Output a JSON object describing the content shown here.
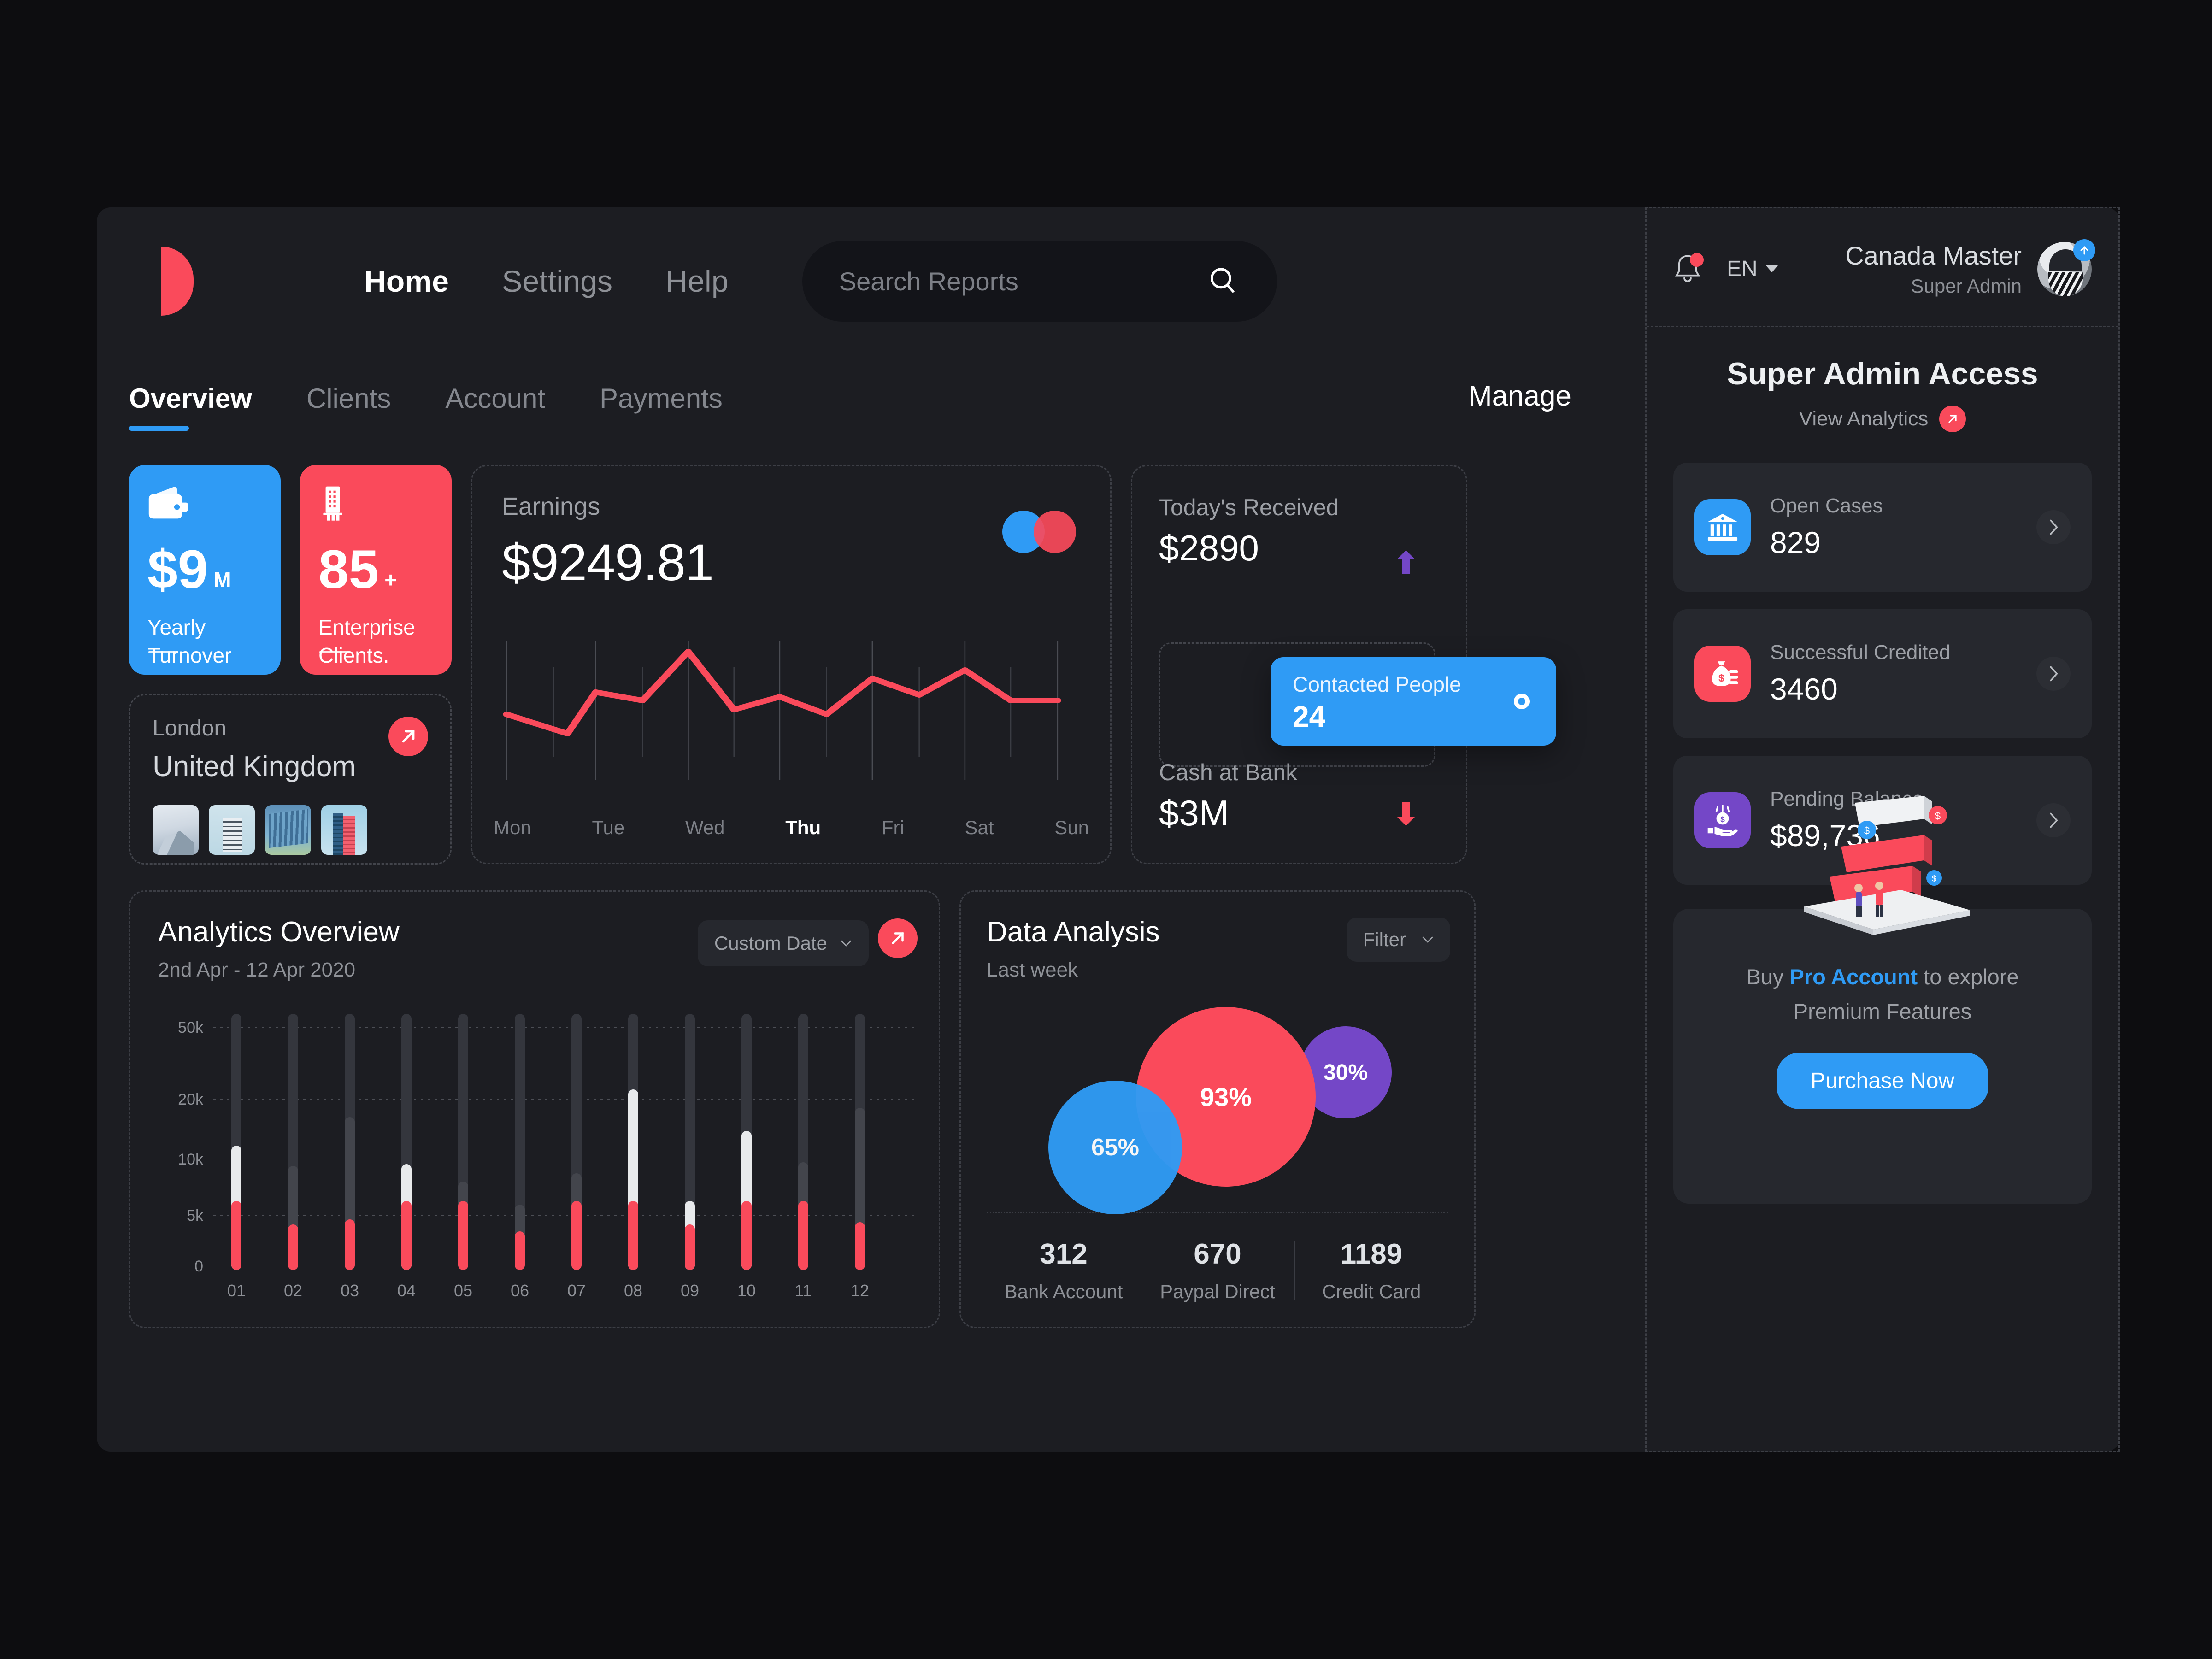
{
  "brand": {
    "logo_name": "half-circle-logo",
    "accent_red": "#fa4a5b",
    "accent_blue": "#2f9bf5",
    "accent_purple": "#7447c7"
  },
  "nav": {
    "items": [
      {
        "label": "Home",
        "active": true
      },
      {
        "label": "Settings",
        "active": false
      },
      {
        "label": "Help",
        "active": false
      }
    ]
  },
  "search": {
    "placeholder": "Search Reports",
    "value": ""
  },
  "tabs": {
    "items": [
      {
        "label": "Overview",
        "active": true
      },
      {
        "label": "Clients",
        "active": false
      },
      {
        "label": "Account",
        "active": false
      },
      {
        "label": "Payments",
        "active": false
      }
    ],
    "manage_label": "Manage"
  },
  "stat_cards": [
    {
      "value": "$9",
      "suffix": "M",
      "line1": "Yearly",
      "line2": "Turnover",
      "color": "#2f9bf5",
      "icon": "wallet-icon"
    },
    {
      "value": "85",
      "suffix": "+",
      "line1": "Enterprise",
      "line2": "Clients.",
      "color": "#fa4a5b",
      "icon": "building-icon"
    }
  ],
  "city_card": {
    "city": "London",
    "country": "United Kingdom"
  },
  "earnings": {
    "title": "Earnings",
    "amount": "$9249.81",
    "days": [
      "Mon",
      "Tue",
      "Wed",
      "Thu",
      "Fri",
      "Sat",
      "Sun"
    ],
    "current_day": "Thu"
  },
  "received": {
    "today_label": "Today's Received",
    "today_value": "$2890",
    "cash_label": "Cash at Bank",
    "cash_value": "$3M",
    "contacted_label": "Contacted People",
    "contacted_value": "24"
  },
  "analytics": {
    "title": "Analytics Overview",
    "subtitle": "2nd Apr - 12 Apr 2020",
    "date_filter_label": "Custom Date"
  },
  "data_analysis": {
    "title": "Data Analysis",
    "subtitle": "Last week",
    "filter_label": "Filter",
    "footer": [
      {
        "num": "312",
        "label": "Bank Account"
      },
      {
        "num": "670",
        "label": "Paypal Direct"
      },
      {
        "num": "1189",
        "label": "Credit Card"
      }
    ]
  },
  "sidebar": {
    "lang": "EN",
    "user_name": "Canada Master",
    "user_role": "Super Admin",
    "title": "Super Admin Access",
    "view_analytics": "View Analytics",
    "rows": [
      {
        "label": "Open Cases",
        "value": "829",
        "icon": "bank-icon",
        "color": "#2f9bf5"
      },
      {
        "label": "Successful Credited",
        "value": "3460",
        "icon": "money-bag-icon",
        "color": "#fa4a5b"
      },
      {
        "label": "Pending Balance",
        "value": "$89,736",
        "icon": "hand-coin-icon",
        "color": "#7447c7"
      }
    ],
    "promo": {
      "line1_a": "Buy ",
      "line1_b": "Pro Account",
      "line1_c": " to explore",
      "line2": "Premium Features",
      "button": "Purchase Now"
    }
  },
  "chart_data": [
    {
      "type": "line",
      "title": "Earnings",
      "x": [
        "Mon",
        "Tue",
        "Wed",
        "Thu",
        "Fri",
        "Sat",
        "Sun"
      ],
      "points_x": [
        0,
        7,
        14,
        21,
        28,
        36,
        43,
        50,
        57,
        64,
        71,
        79,
        86,
        93,
        100
      ],
      "values": [
        52,
        32,
        66,
        62,
        96,
        49,
        58,
        46,
        72,
        62,
        78,
        58,
        58
      ],
      "series": [
        {
          "name": "Earnings",
          "values": [
            52,
            32,
            66,
            62,
            96,
            49,
            58,
            46,
            72,
            62,
            78,
            58,
            58
          ]
        }
      ],
      "ylim": [
        0,
        100
      ],
      "grid": true,
      "legend": "none",
      "color": "#fa4a5b"
    },
    {
      "type": "bar",
      "title": "Analytics Overview",
      "subtitle": "2nd Apr - 12 Apr 2020",
      "categories": [
        "01",
        "02",
        "03",
        "04",
        "05",
        "06",
        "07",
        "08",
        "09",
        "10",
        "11",
        "12"
      ],
      "ytick_labels": [
        "0",
        "5k",
        "10k",
        "20k",
        "50k"
      ],
      "ytick_values": [
        0,
        5000,
        10000,
        20000,
        50000
      ],
      "series": [
        {
          "name": "Primary",
          "color": "#fa4a5b",
          "values": [
            5800,
            3400,
            3900,
            5800,
            5800,
            2900,
            5800,
            5800,
            3400,
            5800,
            5800,
            3500
          ]
        },
        {
          "name": "Secondary",
          "color": "#e8eaec",
          "values": [
            10200,
            3400,
            3900,
            8700,
            5800,
            2900,
            5800,
            20000,
            5400,
            12000,
            5800,
            3500
          ]
        },
        {
          "name": "Track",
          "color": "#3a3c43",
          "values": [
            52000,
            8900,
            15000,
            52000,
            7500,
            6300,
            8400,
            52000,
            52000,
            52000,
            9000,
            17500
          ]
        }
      ],
      "ylim": [
        0,
        52000
      ],
      "grid": true,
      "legend": "none"
    },
    {
      "type": "bubble",
      "title": "Data Analysis",
      "subtitle": "Last week",
      "bubbles": [
        {
          "label": "65%",
          "value": 65,
          "color": "#2f9bf5"
        },
        {
          "label": "93%",
          "value": 93,
          "color": "#fa4a5b"
        },
        {
          "label": "30%",
          "value": 30,
          "color": "#7447c7"
        }
      ],
      "footer_categories": [
        "Bank Account",
        "Paypal Direct",
        "Credit Card"
      ],
      "footer_values": [
        312,
        670,
        1189
      ]
    }
  ]
}
